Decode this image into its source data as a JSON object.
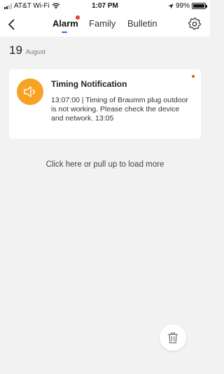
{
  "status_bar": {
    "carrier": "AT&T Wi-Fi",
    "time": "1:07 PM",
    "battery": "99%",
    "battery_level": 0.99,
    "icons": [
      "signal-icon",
      "wifi-icon",
      "location-arrow-icon",
      "battery-icon"
    ]
  },
  "nav": {
    "back_icon": "chevron-left-icon",
    "tabs": [
      {
        "label": "Alarm",
        "active": true,
        "has_badge": true
      },
      {
        "label": "Family",
        "active": false
      },
      {
        "label": "Bulletin",
        "active": false
      }
    ],
    "settings_icon": "gear-icon"
  },
  "date": {
    "day": "19",
    "month": "August"
  },
  "notification": {
    "icon": "speaker-icon",
    "title": "Timing Notification",
    "body": "13:07:00 | Timing of Braumm plug outdoor  is not working. Please check the device and network. 13:05",
    "unread": true
  },
  "load_more": "Click here or pull up to load more",
  "delete_icon": "trash-icon",
  "colors": {
    "accent": "#1a73e8",
    "badge": "#e53b2c",
    "icon_bg": "#f6a323",
    "background": "#f2f2f2"
  }
}
